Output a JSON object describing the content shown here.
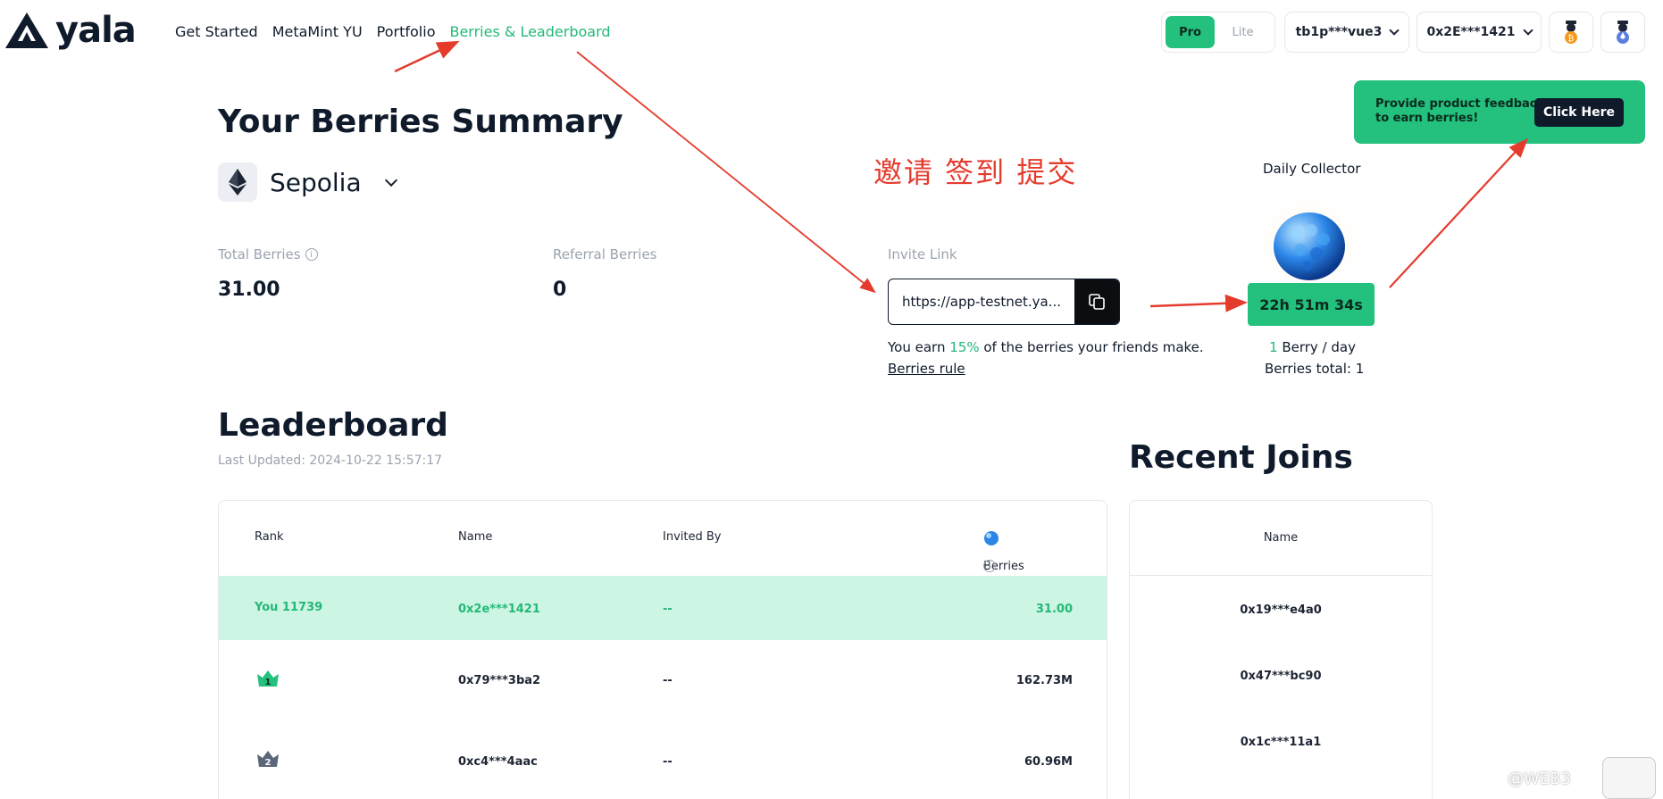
{
  "app": {
    "logo_text": "yala"
  },
  "nav": {
    "items": [
      "Get Started",
      "MetaMint YU",
      "Portfolio",
      "Berries & Leaderboard"
    ]
  },
  "toggle": {
    "pro": "Pro",
    "lite": "Lite"
  },
  "wallets": {
    "btc": "tb1p***vue3",
    "evm": "0x2E***1421"
  },
  "feedback": {
    "text": "Provide product feedback to earn berries!",
    "button": "Click Here"
  },
  "summary": {
    "title": "Your Berries Summary",
    "network": "Sepolia",
    "annotation": "邀请  签到   提交",
    "total_label": "Total Berries",
    "total_value": "31.00",
    "referral_label": "Referral Berries",
    "referral_value": "0",
    "invite_label": "Invite Link",
    "invite_url": "https://app-testnet.ya...",
    "earn_prefix": "You earn ",
    "earn_pct": "15%",
    "earn_suffix": " of the berries your friends make.",
    "rule_link": "Berries rule"
  },
  "daily": {
    "title": "Daily Collector",
    "timer": "22h 51m 34s",
    "per_day_n": "1",
    "per_day_text": " Berry / day",
    "total": "Berries total: 1"
  },
  "leaderboard": {
    "title": "Leaderboard",
    "updated": "Last Updated: 2024-10-22 15:57:17",
    "headers": {
      "rank": "Rank",
      "name": "Name",
      "invited_by": "Invited By",
      "berries": "Berries"
    },
    "you": {
      "rank": "You 11739",
      "name": "0x2e***1421",
      "invited_by": "--",
      "berries": "31.00"
    },
    "rows": [
      {
        "rank": "1",
        "name": "0x79***3ba2",
        "invited_by": "--",
        "berries": "162.73M"
      },
      {
        "rank": "2",
        "name": "0xc4***4aac",
        "invited_by": "--",
        "berries": "60.96M"
      }
    ]
  },
  "recent": {
    "title": "Recent Joins",
    "header": "Name",
    "rows": [
      "0x19***e4a0",
      "0x47***bc90",
      "0x1c***11a1"
    ]
  },
  "watermark": "@WEB3",
  "colors": {
    "accent": "#23c07e",
    "annotation": "#e53b2d"
  }
}
